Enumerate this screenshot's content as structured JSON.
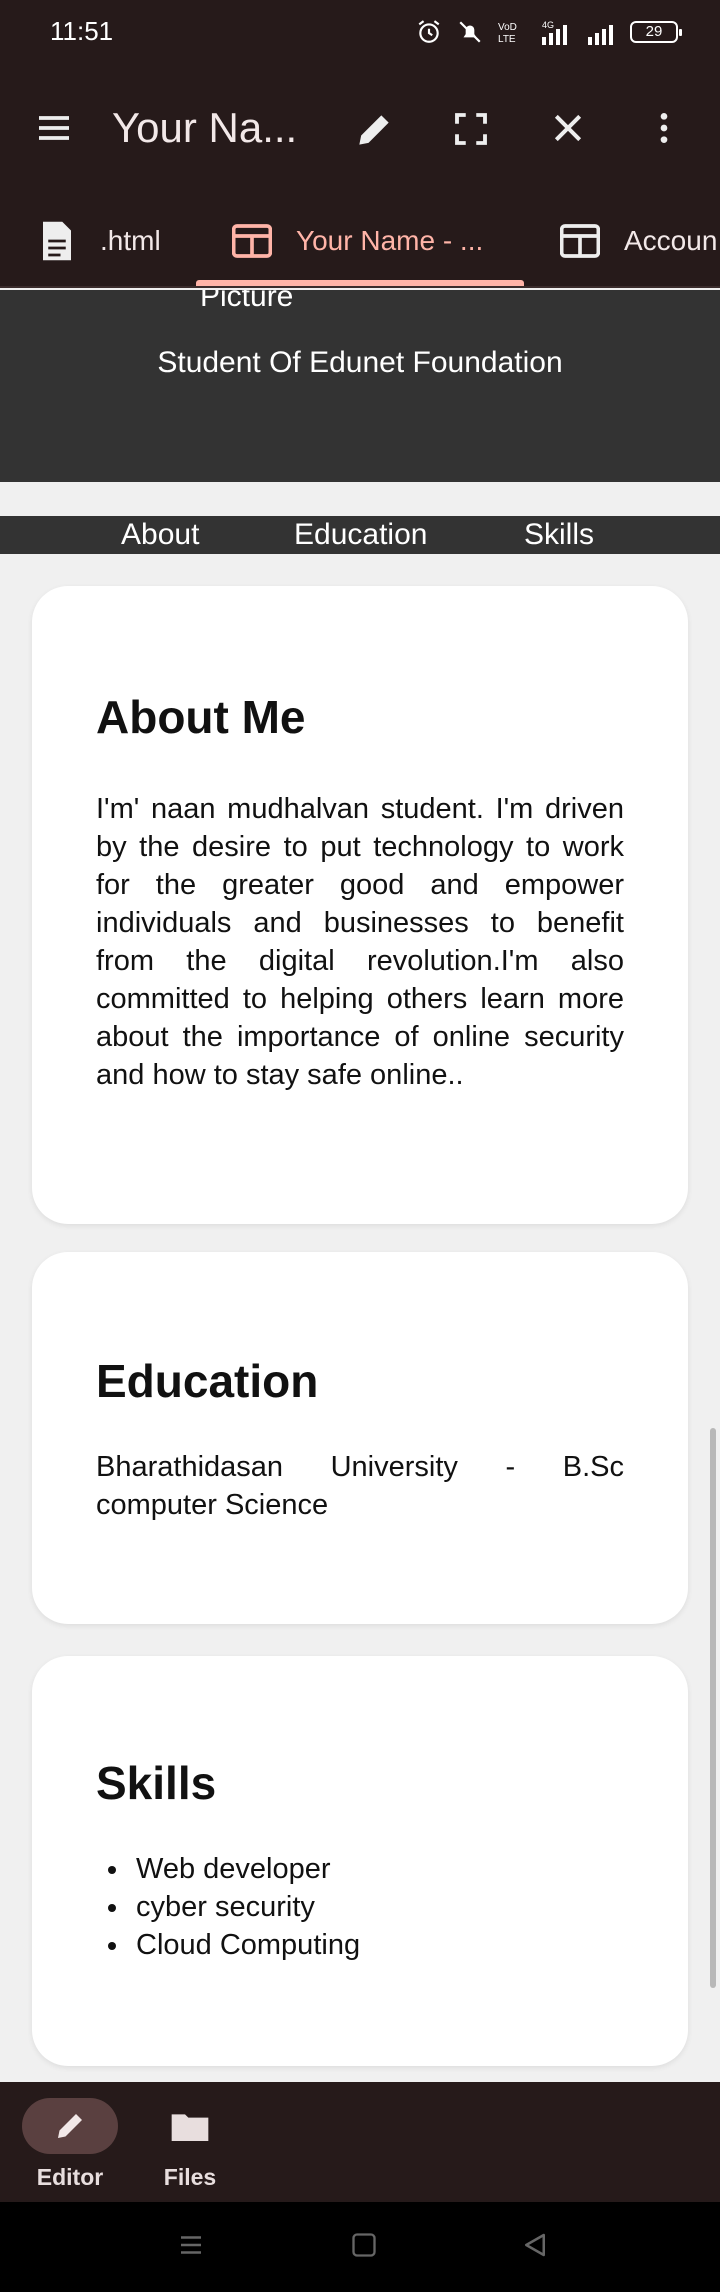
{
  "status": {
    "time": "11:51",
    "battery": "29",
    "network_label": "4G"
  },
  "appbar": {
    "title": "Your Na..."
  },
  "tabs": [
    {
      "label": ".html"
    },
    {
      "label": "Your Name - ..."
    },
    {
      "label": "Accoun"
    }
  ],
  "page": {
    "picture_label": "Picture",
    "subtitle": "Student Of Edunet Foundation",
    "nav": [
      "About",
      "Education",
      "Skills"
    ],
    "about": {
      "title": "About Me",
      "text": "I'm' naan mudhalvan student. I'm driven by the desire to put technology to work for the greater good and empower individuals and businesses to benefit from the digital revolution.I'm also committed to helping others learn more about the importance of online security and how to stay safe online.."
    },
    "education": {
      "title": "Education",
      "text": "Bharathidasan University - B.Sc computer Science"
    },
    "skills": {
      "title": "Skills",
      "items": [
        "Web developer",
        "cyber security",
        "Cloud Computing"
      ]
    }
  },
  "bottomnav": {
    "editor_label": "Editor",
    "files_label": "Files"
  },
  "colors": {
    "toolbar_bg": "#261a1a",
    "accent": "#ffb4a8",
    "header_dark": "#333333"
  }
}
